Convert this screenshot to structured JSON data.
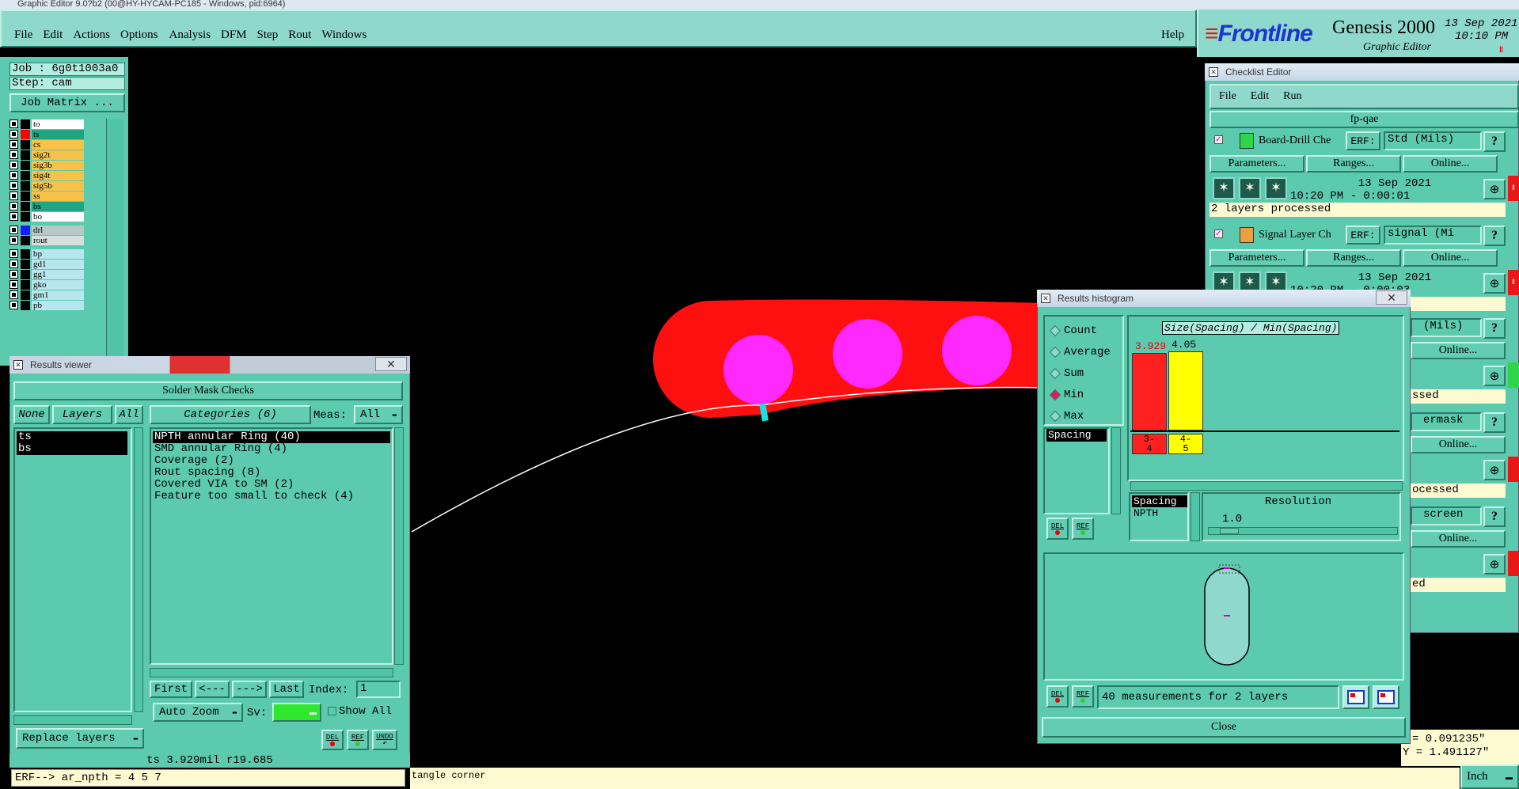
{
  "window_title": "Graphic Editor 9.0?b2 (00@HY-HYCAM-PC185 - Windows, pid:6964)",
  "menu": [
    "File",
    "Edit",
    "Actions",
    "Options",
    "Analysis",
    "DFM",
    "Step",
    "Rout",
    "Windows"
  ],
  "help_label": "Help",
  "brand": {
    "logo": "Frontline",
    "product": "Genesis 2000",
    "subtitle": "Graphic Editor",
    "date": "13 Sep 2021",
    "time": "10:10 PM"
  },
  "job": {
    "job_line": "Job : 6g0t1003a0",
    "step_line": "Step: cam",
    "matrix_button": "Job Matrix ..."
  },
  "layers": [
    {
      "name": "to",
      "color": "#ffffff",
      "mark": "#000000"
    },
    {
      "name": "ts",
      "color": "#1da584",
      "mark": "#ff0000"
    },
    {
      "name": "cs",
      "color": "#f6c24a",
      "mark": "#000000"
    },
    {
      "name": "sig2t",
      "color": "#f6c24a",
      "mark": "#000000"
    },
    {
      "name": "sig3b",
      "color": "#f6c24a",
      "mark": "#000000"
    },
    {
      "name": "sig4t",
      "color": "#f6c24a",
      "mark": "#000000"
    },
    {
      "name": "sig5b",
      "color": "#f6c24a",
      "mark": "#000000"
    },
    {
      "name": "ss",
      "color": "#f6c24a",
      "mark": "#000000"
    },
    {
      "name": "bs",
      "color": "#1da584",
      "mark": "#000000"
    },
    {
      "name": "bo",
      "color": "#ffffff",
      "mark": "#000000"
    },
    {
      "name": "drl",
      "color": "#b8c8c8",
      "mark": "#1a1aff"
    },
    {
      "name": "rout",
      "color": "#d6dede",
      "mark": "#000000"
    },
    {
      "name": "bp",
      "color": "#b7e6ee",
      "mark": "#000000"
    },
    {
      "name": "gd1",
      "color": "#b7e6ee",
      "mark": "#000000"
    },
    {
      "name": "gg1",
      "color": "#b7e6ee",
      "mark": "#000000"
    },
    {
      "name": "gko",
      "color": "#b7e6ee",
      "mark": "#000000"
    },
    {
      "name": "gm1",
      "color": "#b7e6ee",
      "mark": "#000000"
    },
    {
      "name": "pb",
      "color": "#b7e6ee",
      "mark": "#000000"
    }
  ],
  "results_viewer": {
    "title": "Results viewer",
    "header": "Solder Mask Checks",
    "none_label": "None",
    "layers_label": "Layers",
    "all_label": "All",
    "categories_label": "Categories (6)",
    "meas_label": "Meas:",
    "meas_value": "All",
    "layer_items": [
      "ts",
      "bs"
    ],
    "categories": [
      "NPTH annular Ring (40)",
      "SMD annular Ring (4)",
      "Coverage (2)",
      "Rout spacing (8)",
      "Covered VIA to SM (2)",
      "Feature too small to check (4)"
    ],
    "first": "First",
    "prev": "<---",
    "next": "--->",
    "last": "Last",
    "index_label": "Index:",
    "index_value": "1",
    "auto_zoom": "Auto Zoom",
    "sv_label": "Sv:",
    "show_all": "Show All",
    "del": "DEL",
    "ref": "REF",
    "undo": "UNDO",
    "replace_layers": "Replace layers",
    "status": "ts 3.929mil  r19.685"
  },
  "erf_line": "ERF--> ar_npth = 4 5 7",
  "bottom_status": "tangle corner",
  "units": "Inch",
  "coords": {
    "x": "= 0.091235\"",
    "y": "Y = 1.491127\""
  },
  "checklist": {
    "title": "Checklist Editor",
    "menu": [
      "File",
      "Edit",
      "Run"
    ],
    "name": "fp-qae",
    "erf": "ERF:",
    "params": "Parameters...",
    "ranges": "Ranges...",
    "online": "Online...",
    "items": [
      {
        "name": "Board-Drill Che",
        "erf_value": "Std (Mils)",
        "date": "13 Sep 2021",
        "time": "10:20 PM - 0:00:01",
        "status": "2 layers processed",
        "icon_color": "#2fd54a"
      },
      {
        "name": "Signal Layer Ch",
        "erf_value": "signal (Mi",
        "date": "13 Sep 2021",
        "time": "10:20 PM - 0:00:03",
        "status": "",
        "icon_color": "#e8a040"
      }
    ],
    "partial": [
      {
        "erf": "(Mils)",
        "status": "ssed"
      },
      {
        "erf": "ermask",
        "status": "ocessed"
      },
      {
        "erf": "screen",
        "status": "ed"
      }
    ]
  },
  "histogram": {
    "title": "Results histogram",
    "radio": [
      "Count",
      "Average",
      "Sum",
      "Min",
      "Max"
    ],
    "selected": "Min",
    "list_item": "Spacing",
    "chart_title": "Size(Spacing) / Min(Spacing)",
    "bars": [
      {
        "label": "3.929",
        "range": "3-\n4",
        "color": "#ff2020"
      },
      {
        "label": "4.05",
        "range": "4-\n5",
        "color": "#ffff00"
      }
    ],
    "legend_items": [
      "Spacing",
      "NPTH"
    ],
    "resolution_label": "Resolution",
    "resolution_value": "1.0",
    "summary": "40 measurements for 2 layers",
    "close": "Close",
    "del": "DEL",
    "ref": "REF"
  }
}
